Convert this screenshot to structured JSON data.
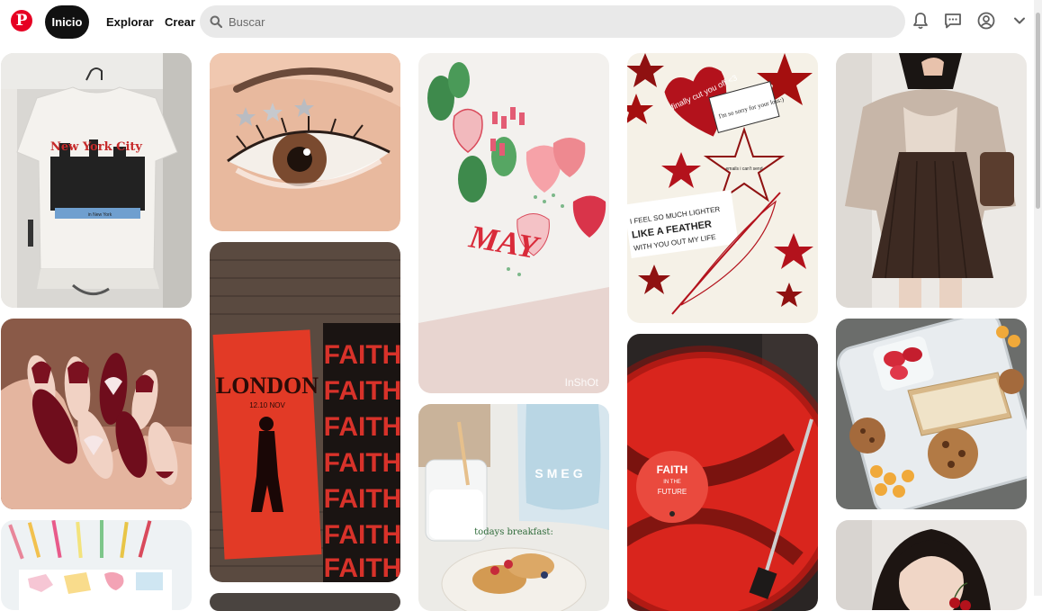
{
  "header": {
    "logo_letter": "P",
    "home_label": "Inicio",
    "explore_label": "Explorar",
    "create_label": "Crear",
    "search_placeholder": "Buscar"
  },
  "icons": {
    "logo": "pinterest-logo",
    "search": "search-icon",
    "notifications": "bell-icon",
    "messages": "chat-icon",
    "profile": "user-avatar-icon",
    "menu": "chevron-down-icon"
  },
  "colors": {
    "brand": "#e60023",
    "nav_active_bg": "#111111",
    "search_bg": "#e9e9e9"
  },
  "pins": {
    "tshirt": {
      "print_title": "New York City",
      "print_caption": "in New York"
    },
    "nails": {},
    "stickers": {},
    "eye_makeup": {},
    "poster": {
      "poster_title": "LONDON",
      "poster_sub": "12.10 NOV",
      "wall_text": "FAITH"
    },
    "strawberry": {
      "word": "MAY",
      "watermark": "InShOt"
    },
    "breakfast": {
      "caption": "todays breakfast:",
      "kettle_brand": "SMEG"
    },
    "collage": {
      "heart_text": "finally cut you off <3",
      "note_text": "I'm so sorry for your loss:)",
      "emails_text": "emails i can't send",
      "feather_text_1": "I FEEL SO MUCH LIGHTER",
      "feather_text_2": "LIKE A FEATHER",
      "feather_text_3": "WITH YOU OUT MY LIFE"
    },
    "vinyl": {
      "label_title": "FAITH",
      "label_sub1": "IN THE",
      "label_sub2": "FUTURE"
    },
    "outfit": {},
    "lunchbox": {},
    "portrait": {}
  }
}
